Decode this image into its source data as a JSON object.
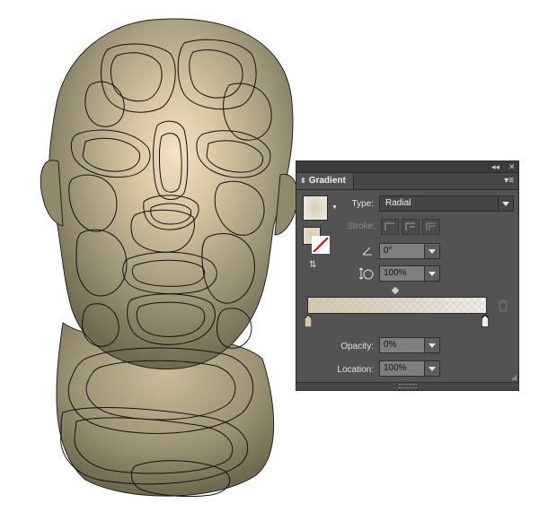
{
  "panel": {
    "title": "Gradient",
    "collapse_icon": "double-chevron-left-icon",
    "close_icon": "close-icon",
    "menu_icon": "panel-menu-icon"
  },
  "type": {
    "label": "Type:",
    "value": "Radial"
  },
  "stroke": {
    "label": "Stroke:"
  },
  "angle": {
    "icon": "angle-icon",
    "value": "0°"
  },
  "aspect_ratio": {
    "icon": "aspect-ratio-icon",
    "value": "100%"
  },
  "gradient_bar": {
    "start_color": "#d6c9a9",
    "end_color": "#f0eeea"
  },
  "opacity": {
    "label": "Opacity:",
    "value": "0%"
  },
  "location": {
    "label": "Location:",
    "value": "100%"
  },
  "colors": {
    "panel_bg": "#535353",
    "face_fill": "#9f9778",
    "face_highlight": "#f1dfbf",
    "outline": "#111111"
  }
}
